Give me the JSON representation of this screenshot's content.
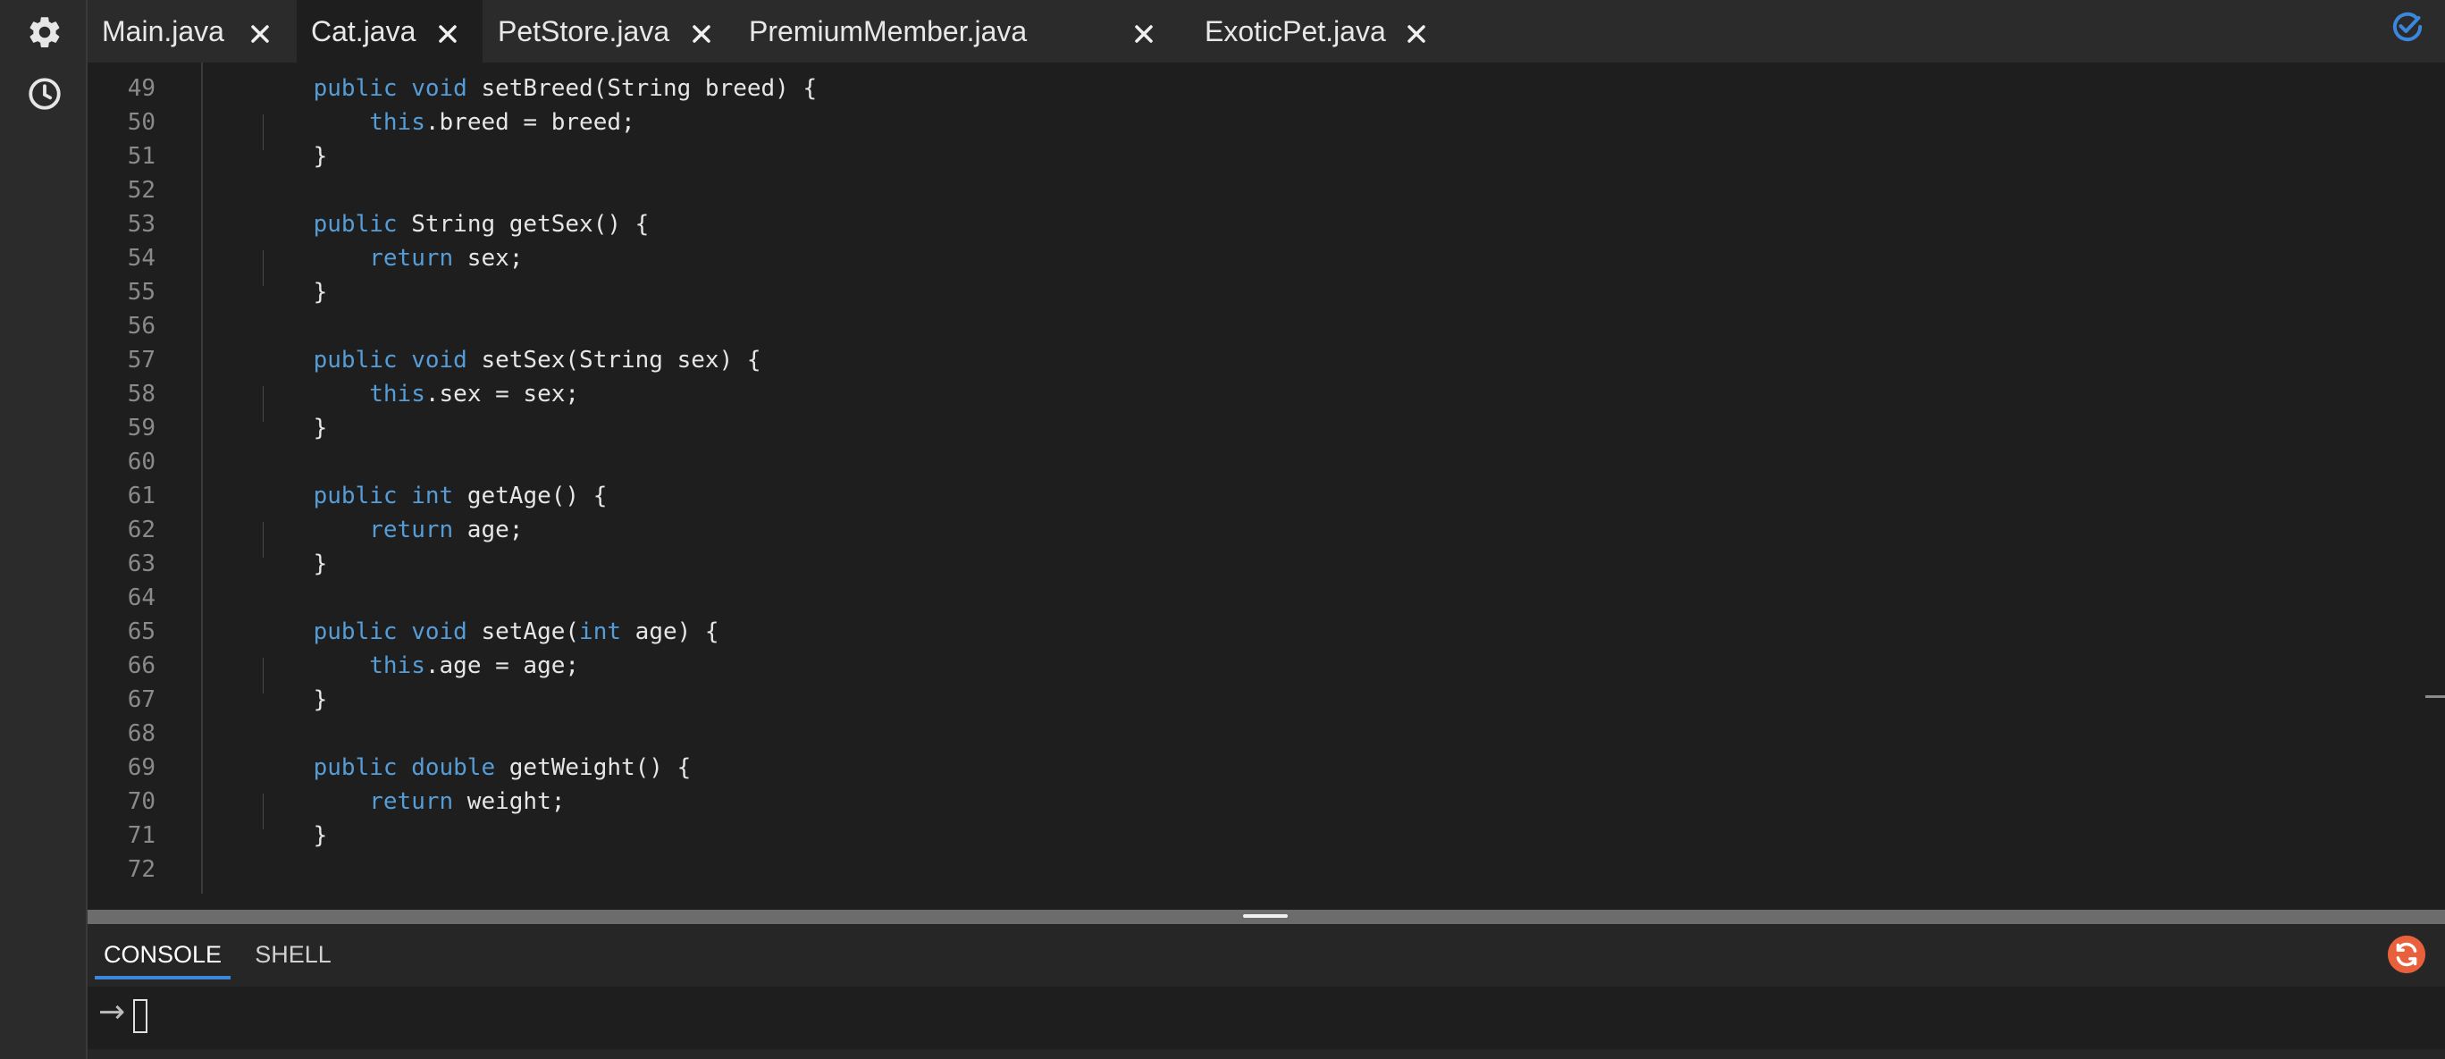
{
  "tabs": [
    {
      "label": "Main.java",
      "active": false
    },
    {
      "label": "Cat.java",
      "active": true
    },
    {
      "label": "PetStore.java",
      "active": false
    },
    {
      "label": "PremiumMember.java",
      "active": false
    },
    {
      "label": "ExoticPet.java",
      "active": false
    }
  ],
  "icons": {
    "settings": "gear-icon",
    "history": "clock-icon",
    "close": "close-icon",
    "status": "check-circle-icon",
    "refresh": "refresh-icon"
  },
  "editor": {
    "lines": [
      {
        "n": "49",
        "pre": "    ",
        "kw": "public void",
        "rest": " setBreed(String breed) {"
      },
      {
        "n": "50",
        "pre": "        ",
        "kw": "this",
        "rest": ".breed = breed;"
      },
      {
        "n": "51",
        "pre": "    ",
        "kw": "",
        "rest": "}"
      },
      {
        "n": "52",
        "pre": "",
        "kw": "",
        "rest": ""
      },
      {
        "n": "53",
        "pre": "    ",
        "kw": "public",
        "rest": " String getSex() {"
      },
      {
        "n": "54",
        "pre": "        ",
        "kw": "return",
        "rest": " sex;"
      },
      {
        "n": "55",
        "pre": "    ",
        "kw": "",
        "rest": "}"
      },
      {
        "n": "56",
        "pre": "",
        "kw": "",
        "rest": ""
      },
      {
        "n": "57",
        "pre": "    ",
        "kw": "public void",
        "rest": " setSex(String sex) {"
      },
      {
        "n": "58",
        "pre": "        ",
        "kw": "this",
        "rest": ".sex = sex;"
      },
      {
        "n": "59",
        "pre": "    ",
        "kw": "",
        "rest": "}"
      },
      {
        "n": "60",
        "pre": "",
        "kw": "",
        "rest": ""
      },
      {
        "n": "61",
        "pre": "    ",
        "kw": "public int",
        "rest": " getAge() {"
      },
      {
        "n": "62",
        "pre": "        ",
        "kw": "return",
        "rest": " age;"
      },
      {
        "n": "63",
        "pre": "    ",
        "kw": "",
        "rest": "}"
      },
      {
        "n": "64",
        "pre": "",
        "kw": "",
        "rest": ""
      },
      {
        "n": "65",
        "pre": "    ",
        "kw": "public void",
        "rest": " setAge(",
        "kw2": "int",
        "rest2": " age) {"
      },
      {
        "n": "66",
        "pre": "        ",
        "kw": "this",
        "rest": ".age = age;"
      },
      {
        "n": "67",
        "pre": "    ",
        "kw": "",
        "rest": "}"
      },
      {
        "n": "68",
        "pre": "",
        "kw": "",
        "rest": ""
      },
      {
        "n": "69",
        "pre": "    ",
        "kw": "public double",
        "rest": " getWeight() {"
      },
      {
        "n": "70",
        "pre": "        ",
        "kw": "return",
        "rest": " weight;"
      },
      {
        "n": "71",
        "pre": "    ",
        "kw": "",
        "rest": "}"
      },
      {
        "n": "72",
        "pre": "",
        "kw": "",
        "rest": ""
      }
    ]
  },
  "panel": {
    "tabs": [
      {
        "label": "CONSOLE",
        "active": true
      },
      {
        "label": "SHELL",
        "active": false
      }
    ],
    "prompt": "→"
  },
  "colors": {
    "keyword": "#569cd6",
    "accent": "#3a87dd",
    "refresh": "#e8603c"
  }
}
